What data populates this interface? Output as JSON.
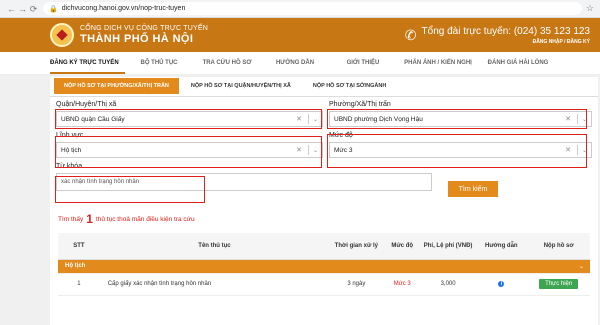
{
  "browser": {
    "url": "dichvucong.hanoi.gov.vn/nop-truc-tuyen"
  },
  "header": {
    "brand_line1": "CỔNG DỊCH VỤ CÔNG TRỰC TUYẾN",
    "brand_line2": "THÀNH PHỐ HÀ NỘI",
    "hotline": "Tổng đài trực tuyến: (024) 35 123 123",
    "auth": "ĐĂNG NHẬP  /  ĐĂNG KÝ"
  },
  "menu": [
    "ĐĂNG KÝ TRỰC TUYẾN",
    "BỘ THỦ TỤC",
    "TRA CỨU HỒ SƠ",
    "HƯỚNG DẪN",
    "GIỚI THIỆU",
    "PHẢN ÁNH / KIẾN NGHỊ",
    "ĐÁNH GIÁ HÀI LÒNG"
  ],
  "tabs": [
    "NỘP HỒ SƠ TẠI PHƯỜNG/XÃ/THỊ TRẤN",
    "NỘP HỒ SƠ TẠI QUẬN/HUYỆN/THỊ XÃ",
    "NỘP HỒ SƠ TẠI SỞ/NGÀNH"
  ],
  "form": {
    "district": {
      "label": "Quận/Huyện/Thị xã",
      "value": "UBND quận Cầu Giấy"
    },
    "ward": {
      "label": "Phường/Xã/Thị trấn",
      "value": "UBND phường Dịch Vọng Hậu"
    },
    "field": {
      "label": "Lĩnh vực",
      "value": "Hộ tịch"
    },
    "level": {
      "label": "Mức độ",
      "value": "Mức 3"
    },
    "keyword": {
      "label": "Từ khóa",
      "value": "xác nhận tình trạng hôn nhân"
    },
    "search_button": "Tìm kiếm"
  },
  "results": {
    "prefix": "Tìm thấy",
    "count": "1",
    "suffix": "thủ tục thoả mãn điều kiện tra cứu"
  },
  "table": {
    "headers": [
      "STT",
      "Tên thủ tục",
      "Thời gian xử lý",
      "Mức độ",
      "Phí, Lệ phí (VNĐ)",
      "Hướng dẫn",
      "Nộp hồ sơ"
    ],
    "group": "Hộ tịch",
    "rows": [
      {
        "stt": "1",
        "name": "Cấp giấy xác nhận tình trạng hôn nhân",
        "time": "3 ngày",
        "level": "Mức 3",
        "fee": "3,000",
        "action": "Thực hiện"
      }
    ]
  }
}
